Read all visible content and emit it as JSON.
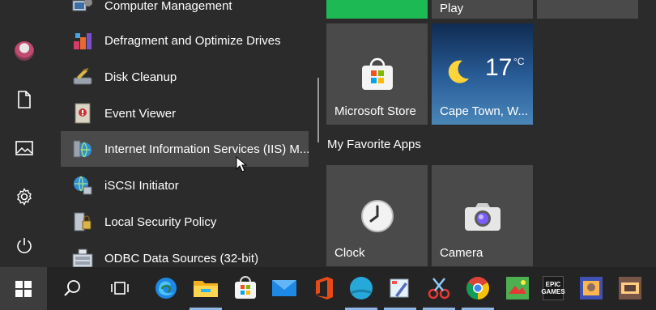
{
  "apps": [
    {
      "label": "Computer Management",
      "icon": "computer-management-icon"
    },
    {
      "label": "Defragment and Optimize Drives",
      "icon": "defragment-icon"
    },
    {
      "label": "Disk Cleanup",
      "icon": "disk-cleanup-icon"
    },
    {
      "label": "Event Viewer",
      "icon": "event-viewer-icon"
    },
    {
      "label": "Internet Information Services (IIS) M...",
      "icon": "iis-manager-icon"
    },
    {
      "label": "iSCSI Initiator",
      "icon": "iscsi-icon"
    },
    {
      "label": "Local Security Policy",
      "icon": "security-policy-icon"
    },
    {
      "label": "ODBC Data Sources (32-bit)",
      "icon": "odbc-icon"
    }
  ],
  "tiles": {
    "play_label": "Play",
    "store_label": "Microsoft Store",
    "weather_city": "Cape Town, W...",
    "weather_temp": "17",
    "weather_unit": "°C",
    "group_title": "My Favorite Apps",
    "clock_label": "Clock",
    "camera_label": "Camera"
  },
  "taskbar": {
    "icons": [
      "windows-start-icon",
      "search-icon",
      "task-view-icon",
      "edge-icon",
      "file-explorer-icon",
      "microsoft-store-icon",
      "mail-icon",
      "office-icon",
      "web-icon",
      "paint-icon",
      "snip-icon",
      "chrome-icon",
      "game-icon",
      "epic-games-icon",
      "game2-icon",
      "game3-icon"
    ],
    "epic_text": "EPIC\nGAMES"
  },
  "colors": {
    "accent_green": "#16a34a",
    "tile_bg": "#4a4a4a",
    "weather_bg": "#1e4a7a",
    "taskbar_bg": "#242424"
  }
}
